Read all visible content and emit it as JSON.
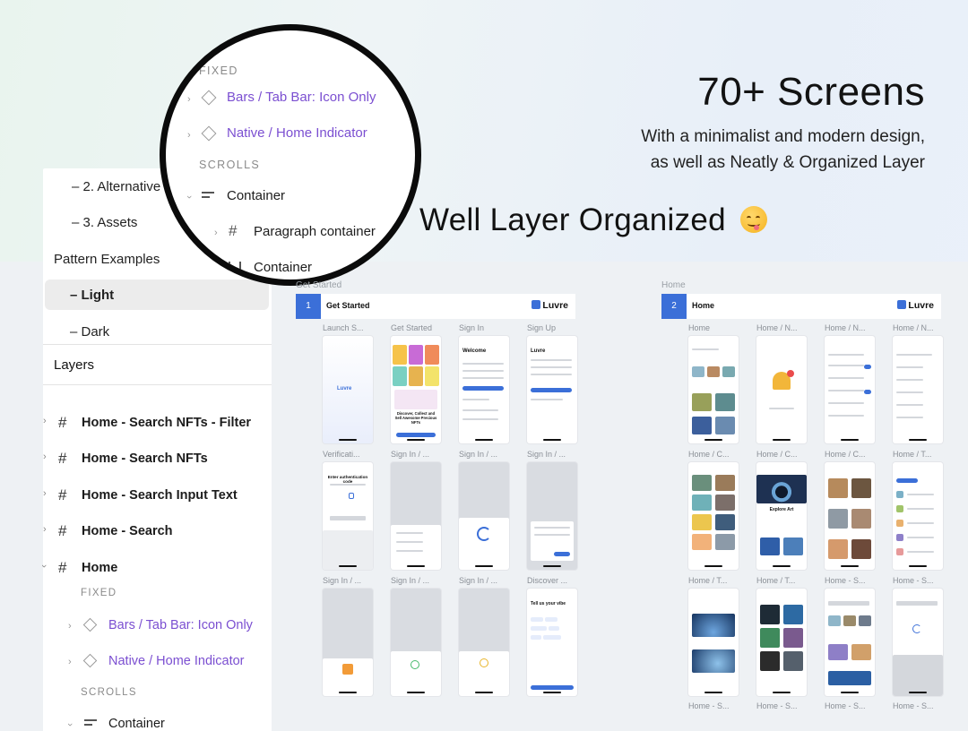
{
  "headline": {
    "title": "70+ Screens",
    "sub_line1": "With a minimalist and modern design,",
    "sub_line2": "as well as Neatly & Organized Layer"
  },
  "big_title": "Well Layer Organized",
  "pages": {
    "items": [
      "– 2. Alternative",
      "– 3. Assets",
      "Pattern Examples",
      "– Light",
      "– Dark"
    ],
    "active": "– Light"
  },
  "layers": {
    "title": "Layers",
    "rows": [
      "Home - Search NFTs - Filter",
      "Home - Search NFTs",
      "Home - Search Input Text",
      "Home - Search",
      "Home"
    ],
    "fixed_label": "FIXED",
    "scrolls_label": "SCROLLS",
    "components": [
      "Bars / Tab Bar: Icon Only",
      "Native / Home Indicator"
    ],
    "container": "Container"
  },
  "magnifier": {
    "fixed_label": "FIXED",
    "scrolls_label": "SCROLLS",
    "comp1": "Bars / Tab Bar: Icon Only",
    "comp2": "Native / Home Indicator",
    "container": "Container",
    "paragraph": "Paragraph container",
    "container2": "Container",
    "add_icon": "+"
  },
  "frames": {
    "get_started": {
      "label": "Get Started",
      "num": "1",
      "title": "Get Started",
      "logo": "Luvre",
      "screens": [
        "Launch S...",
        "Get Started",
        "Sign In",
        "Sign Up",
        "Verificati...",
        "Sign In / ...",
        "Sign In / ...",
        "Sign In / ...",
        "Sign In / ...",
        "Sign In / ...",
        "Sign In / ...",
        "Discover ..."
      ]
    },
    "home": {
      "label": "Home",
      "num": "2",
      "title": "Home",
      "logo": "Luvre",
      "screens": [
        "Home",
        "Home / N...",
        "Home / N...",
        "Home / N...",
        "Home / C...",
        "Home / C...",
        "Home / C...",
        "Home / T...",
        "Home / T...",
        "Home / T...",
        "Home - S...",
        "Home - S...",
        "Home - S...",
        "Home - S...",
        "Home - S...",
        "Home - S..."
      ]
    }
  },
  "screen_texts": {
    "welcome": "Welcome",
    "luvre": "Luvre",
    "discover": "Discover, Collect and Sell Awesome Precious NFTs",
    "enter_code": "Enter authentication code",
    "explore_art": "Explore Art",
    "tell_us": "Tell us your vibe"
  },
  "colors": {
    "accent": "#3b6fd8",
    "purple": "#7b4fd1"
  }
}
